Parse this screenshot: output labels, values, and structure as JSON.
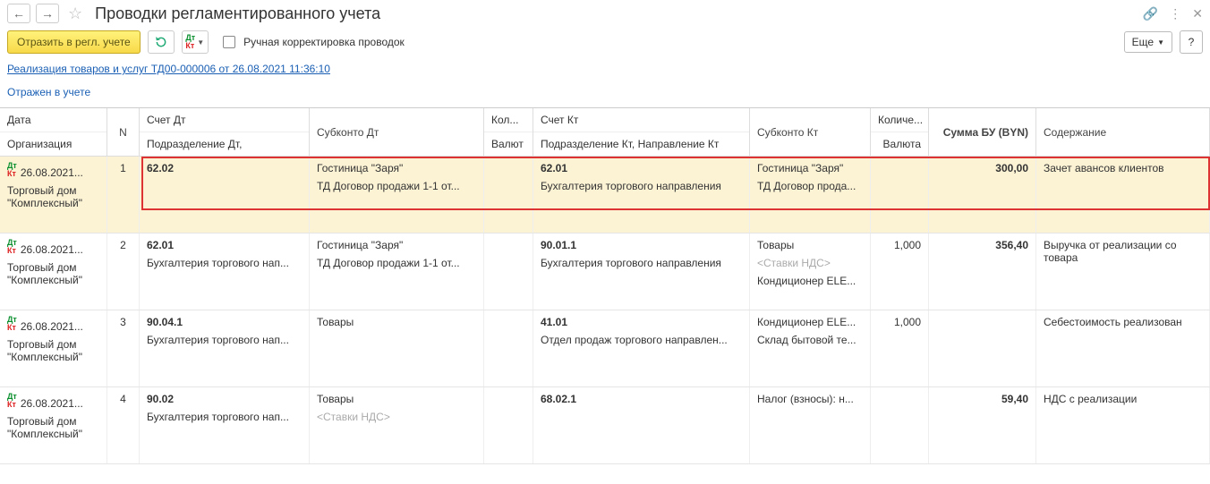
{
  "header": {
    "title": "Проводки регламентированного учета",
    "more_label": "Еще"
  },
  "toolbar": {
    "reflect_label": "Отразить в регл. учете",
    "manual_edit_label": "Ручная корректировка проводок"
  },
  "doc_link": "Реализация товаров и услуг ТД00-000006 от 26.08.2021 11:36:10",
  "status": "Отражен в учете",
  "columns": {
    "date": "Дата",
    "org": "Организация",
    "n": "N",
    "acc_dt": "Счет Дт",
    "dept_dt": "Подразделение Дт,",
    "sub_dt": "Субконто Дт",
    "qty": "Кол...",
    "currency": "Валют",
    "acc_kt": "Счет Кт",
    "dept_kt": "Подразделение Кт, Направление Кт",
    "sub_kt": "Субконто Кт",
    "qty2": "Количе...",
    "currency2": "Валюта",
    "sum": "Сумма БУ (BYN)",
    "desc": "Содержание"
  },
  "rows": [
    {
      "highlighted": true,
      "date": "26.08.2021...",
      "org": "Торговый дом \"Комплексный\"",
      "n": "1",
      "acc_dt": "62.02",
      "dept_dt": "",
      "sub_dt_l1": "Гостиница \"Заря\"",
      "sub_dt_l2": "ТД Договор продажи 1-1 от...",
      "qty": "",
      "cur": "",
      "acc_kt": "62.01",
      "dept_kt": "Бухгалтерия торгового направления",
      "sub_kt_l1": "Гостиница \"Заря\"",
      "sub_kt_l2": "ТД Договор прода...",
      "sub_kt_l3": "",
      "qty2": "",
      "sum": "300,00",
      "desc": "Зачет авансов клиентов"
    },
    {
      "highlighted": false,
      "date": "26.08.2021...",
      "org": "Торговый дом \"Комплексный\"",
      "n": "2",
      "acc_dt": "62.01",
      "dept_dt": "Бухгалтерия торгового нап...",
      "sub_dt_l1": "Гостиница \"Заря\"",
      "sub_dt_l2": "ТД Договор продажи 1-1 от...",
      "qty": "",
      "cur": "",
      "acc_kt": "90.01.1",
      "dept_kt": "Бухгалтерия торгового направления",
      "sub_kt_l1": "Товары",
      "sub_kt_l2": "<Ставки НДС>",
      "sub_kt_l3": "Кондиционер ELE...",
      "qty2": "1,000",
      "sum": "356,40",
      "desc": "Выручка от реализации со товара"
    },
    {
      "highlighted": false,
      "date": "26.08.2021...",
      "org": "Торговый дом \"Комплексный\"",
      "n": "3",
      "acc_dt": "90.04.1",
      "dept_dt": "Бухгалтерия торгового нап...",
      "sub_dt_l1": "Товары",
      "sub_dt_l2": "",
      "qty": "",
      "cur": "",
      "acc_kt": "41.01",
      "dept_kt": "Отдел продаж торгового направлен...",
      "sub_kt_l1": "Кондиционер ELE...",
      "sub_kt_l2": "Склад бытовой те...",
      "sub_kt_l3": "",
      "qty2": "1,000",
      "sum": "",
      "desc": "Себестоимость реализован"
    },
    {
      "highlighted": false,
      "date": "26.08.2021...",
      "org": "Торговый дом \"Комплексный\"",
      "n": "4",
      "acc_dt": "90.02",
      "dept_dt": "Бухгалтерия торгового нап...",
      "sub_dt_l1": "Товары",
      "sub_dt_l2": "<Ставки НДС>",
      "qty": "",
      "cur": "",
      "acc_kt": "68.02.1",
      "dept_kt": "",
      "sub_kt_l1": "Налог (взносы): н...",
      "sub_kt_l2": "",
      "sub_kt_l3": "",
      "qty2": "",
      "sum": "59,40",
      "desc": "НДС с реализации"
    }
  ]
}
